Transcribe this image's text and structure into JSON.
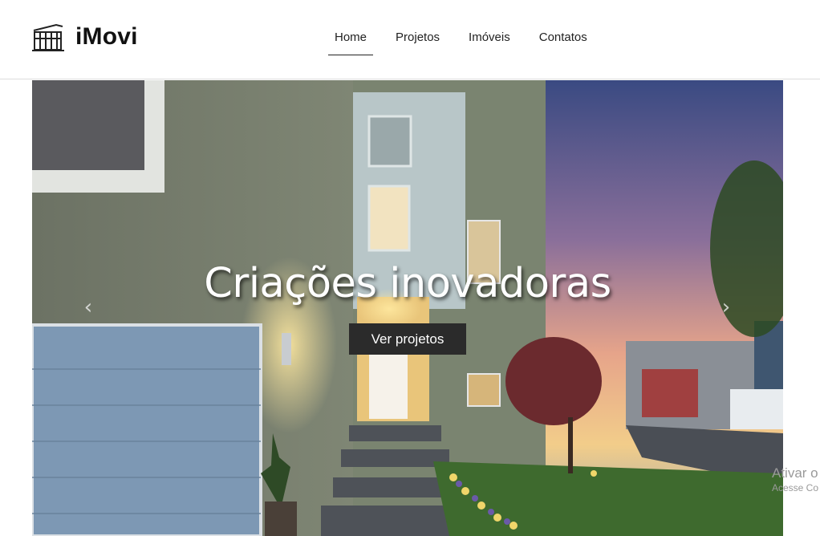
{
  "header": {
    "brand": "iMovi",
    "logo_icon": "building-icon",
    "nav": [
      {
        "label": "Home",
        "active": true
      },
      {
        "label": "Projetos",
        "active": false
      },
      {
        "label": "Imóveis",
        "active": false
      },
      {
        "label": "Contatos",
        "active": false
      }
    ]
  },
  "hero": {
    "title": "Criações inovadoras",
    "button_label": "Ver projetos",
    "prev_glyph": "‹",
    "next_glyph": "›",
    "prev_icon": "chevron-left-icon",
    "next_icon": "chevron-right-icon"
  },
  "watermark": {
    "line1": "Ativar o",
    "line2": "Acesse Co"
  },
  "colors": {
    "header_bg": "#ffffff",
    "button_bg": "#2b2b2b",
    "text_dark": "#222222"
  }
}
